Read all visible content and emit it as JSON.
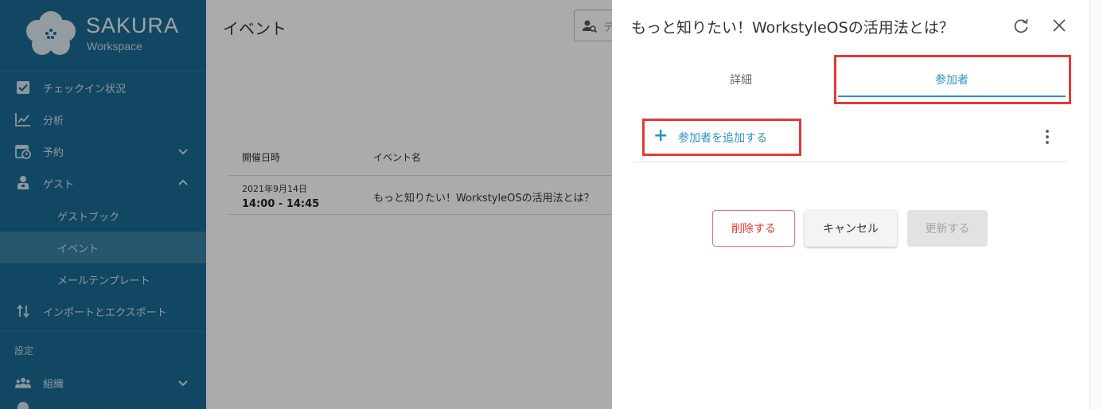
{
  "brand": {
    "name": "SAKURA",
    "subtitle": "Workspace"
  },
  "sidebar": {
    "items": [
      {
        "label": "チェックイン状況",
        "icon": "checkbox-icon"
      },
      {
        "label": "分析",
        "icon": "chart-line-icon"
      },
      {
        "label": "予約",
        "icon": "calendar-clock-icon",
        "chevron": "down"
      },
      {
        "label": "ゲスト",
        "icon": "guest-icon",
        "chevron": "up"
      },
      {
        "label": "インポートとエクスポート",
        "icon": "import-export-icon"
      },
      {
        "label": "組織",
        "icon": "people-icon",
        "chevron": "down"
      }
    ],
    "guest_subitems": [
      "ゲストブック",
      "イベント",
      "メールテンプレート"
    ],
    "active_subitem": "イベント",
    "section_label": "設定"
  },
  "main": {
    "page_title": "イベント",
    "search_placeholder": "テ",
    "table": {
      "headers": [
        "開催日時",
        "イベント名"
      ],
      "rows": [
        {
          "date": "2021年9月14日",
          "time": "14:00 - 14:45",
          "name": "もっと知りたい！WorkstyleOSの活用法とは？"
        }
      ]
    }
  },
  "drawer": {
    "title": "もっと知りたい！WorkstyleOSの活用法とは？",
    "tabs": [
      {
        "label": "詳細",
        "active": false
      },
      {
        "label": "参加者",
        "active": true
      }
    ],
    "add_participant_label": "参加者を追加する",
    "buttons": {
      "delete": "削除する",
      "cancel": "キャンセル",
      "update": "更新する"
    }
  },
  "colors": {
    "sidebar_bg": "#1c6a94",
    "sidebar_active": "#3a7fa5",
    "accent": "#2a93c0",
    "highlight": "#e53935",
    "delete": "#e53935"
  }
}
